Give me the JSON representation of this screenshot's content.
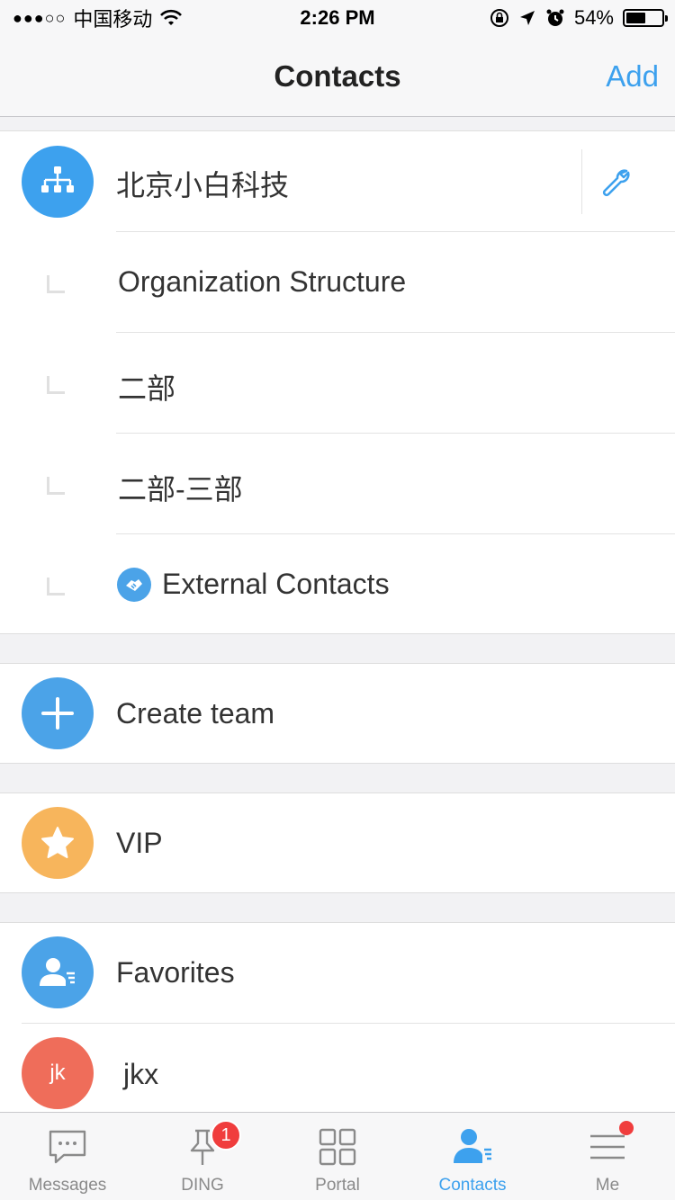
{
  "status_bar": {
    "carrier": "中国移动",
    "signal_dots": "●●●○○",
    "time": "2:26 PM",
    "battery_percent": "54%",
    "battery_level": 0.54
  },
  "nav": {
    "title": "Contacts",
    "add_label": "Add"
  },
  "organization": {
    "name": "北京小白科技",
    "items": [
      {
        "label": "Organization Structure"
      },
      {
        "label": "二部"
      },
      {
        "label": "二部-三部"
      },
      {
        "label": "External Contacts"
      }
    ]
  },
  "create_team": {
    "label": "Create team"
  },
  "vip": {
    "label": "VIP"
  },
  "favorites": {
    "label": "Favorites"
  },
  "contact": {
    "initials": "jk",
    "name": "jkx"
  },
  "tabs": [
    {
      "label": "Messages",
      "icon": "chat-bubble-icon"
    },
    {
      "label": "DING",
      "icon": "pin-icon",
      "badge": "1"
    },
    {
      "label": "Portal",
      "icon": "grid-icon"
    },
    {
      "label": "Contacts",
      "icon": "contacts-icon",
      "active": true
    },
    {
      "label": "Me",
      "icon": "menu-icon",
      "dot": true
    }
  ],
  "colors": {
    "accent": "#3da1ee",
    "org_avatar": "#3da1ee",
    "team_avatar": "#4ba3e8",
    "vip_avatar": "#f7b55c",
    "favorites_avatar": "#4ba3e8",
    "contact_avatar": "#ef6d5a",
    "badge": "#f03d3d"
  }
}
